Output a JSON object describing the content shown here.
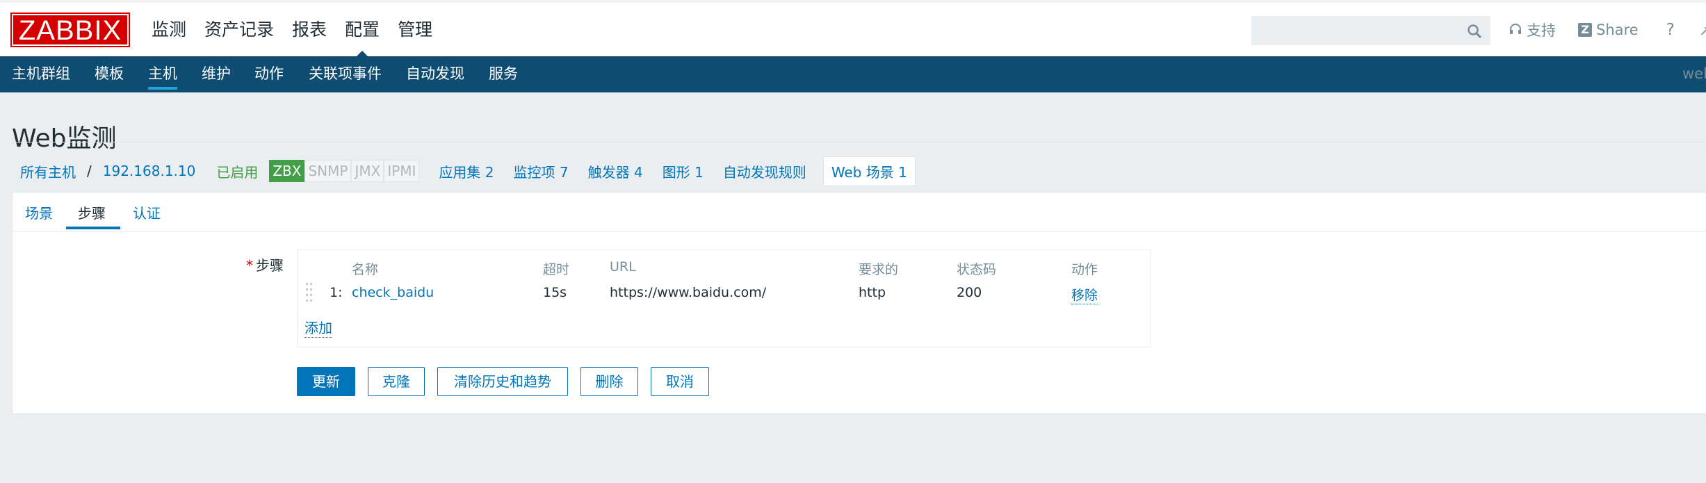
{
  "header": {
    "logo": "ZABBIX",
    "menu": [
      "监测",
      "资产记录",
      "报表",
      "配置",
      "管理"
    ],
    "active_menu": "配置",
    "search_placeholder": "",
    "support": "支持",
    "share": "Share",
    "share_icon_letter": "Z",
    "help": "?",
    "corner_glyph": "↗"
  },
  "subnav": {
    "items": [
      "主机群组",
      "模板",
      "主机",
      "维护",
      "动作",
      "关联项事件",
      "自动发现",
      "服务"
    ],
    "active": "主机",
    "right_text": "web"
  },
  "page_title": "Web监测",
  "breadcrumb": {
    "all_hosts": "所有主机",
    "separator": "/",
    "host": "192.168.1.10",
    "status": "已启用",
    "availability": [
      "ZBX",
      "SNMP",
      "JMX",
      "IPMI"
    ],
    "availability_active": "ZBX",
    "links": [
      {
        "label": "应用集",
        "count": "2"
      },
      {
        "label": "监控项",
        "count": "7"
      },
      {
        "label": "触发器",
        "count": "4"
      },
      {
        "label": "图形",
        "count": "1"
      },
      {
        "label": "自动发现规则",
        "count": ""
      },
      {
        "label": "Web 场景",
        "count": "1"
      }
    ]
  },
  "tabs": [
    "场景",
    "步骤",
    "认证"
  ],
  "active_tab": "步骤",
  "steps": {
    "label": "步骤",
    "required_mark": "*",
    "columns": [
      "名称",
      "超时",
      "URL",
      "要求的",
      "状态码",
      "动作"
    ],
    "rows": [
      {
        "index": "1:",
        "name": "check_baidu",
        "timeout": "15s",
        "url": "https://www.baidu.com/",
        "required": "http",
        "status_codes": "200",
        "action": "移除"
      }
    ],
    "add_label": "添加"
  },
  "buttons": {
    "update": "更新",
    "clone": "克隆",
    "clear_history": "清除历史和趋势",
    "delete": "删除",
    "cancel": "取消"
  },
  "colors": {
    "brand_red": "#d40000",
    "nav_blue": "#0e4d71",
    "link_blue": "#0275b8",
    "enabled_green": "#429e47"
  }
}
